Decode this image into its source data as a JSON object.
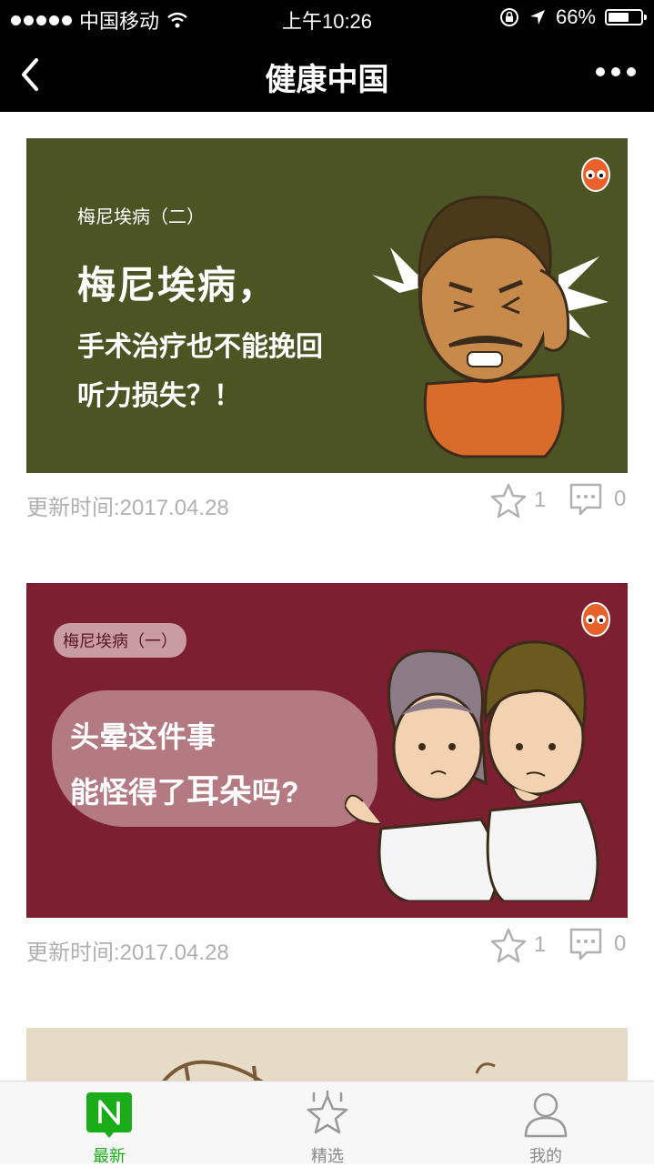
{
  "status_bar": {
    "carrier": "中国移动",
    "time": "上午10:26",
    "battery": "66%",
    "battery_level": 0.66
  },
  "nav": {
    "title": "健康中国"
  },
  "cards": [
    {
      "tag": "梅尼埃病（二）",
      "headline": "梅尼埃病，",
      "line2": "手术治疗也不能挽回",
      "line3": "听力损失？！",
      "date": "更新时间:2017.04.28",
      "likes": "1",
      "comments": "0"
    },
    {
      "tag": "梅尼埃病（一）",
      "line1": "头晕这件事",
      "line2a": "能怪得了",
      "line2b": "耳朵",
      "line2c": "吗?",
      "date": "更新时间:2017.04.28",
      "likes": "1",
      "comments": "0"
    }
  ],
  "tabs": [
    {
      "label": "最新",
      "icon": "n-badge-icon",
      "active": true
    },
    {
      "label": "精选",
      "icon": "star-icon",
      "active": false
    },
    {
      "label": "我的",
      "icon": "person-icon",
      "active": false
    }
  ],
  "colors": {
    "accent": "#1aad19",
    "card1_bg": "#4b5422",
    "card2_bg": "#7b1f31",
    "meta_text": "#b0b0b0"
  }
}
